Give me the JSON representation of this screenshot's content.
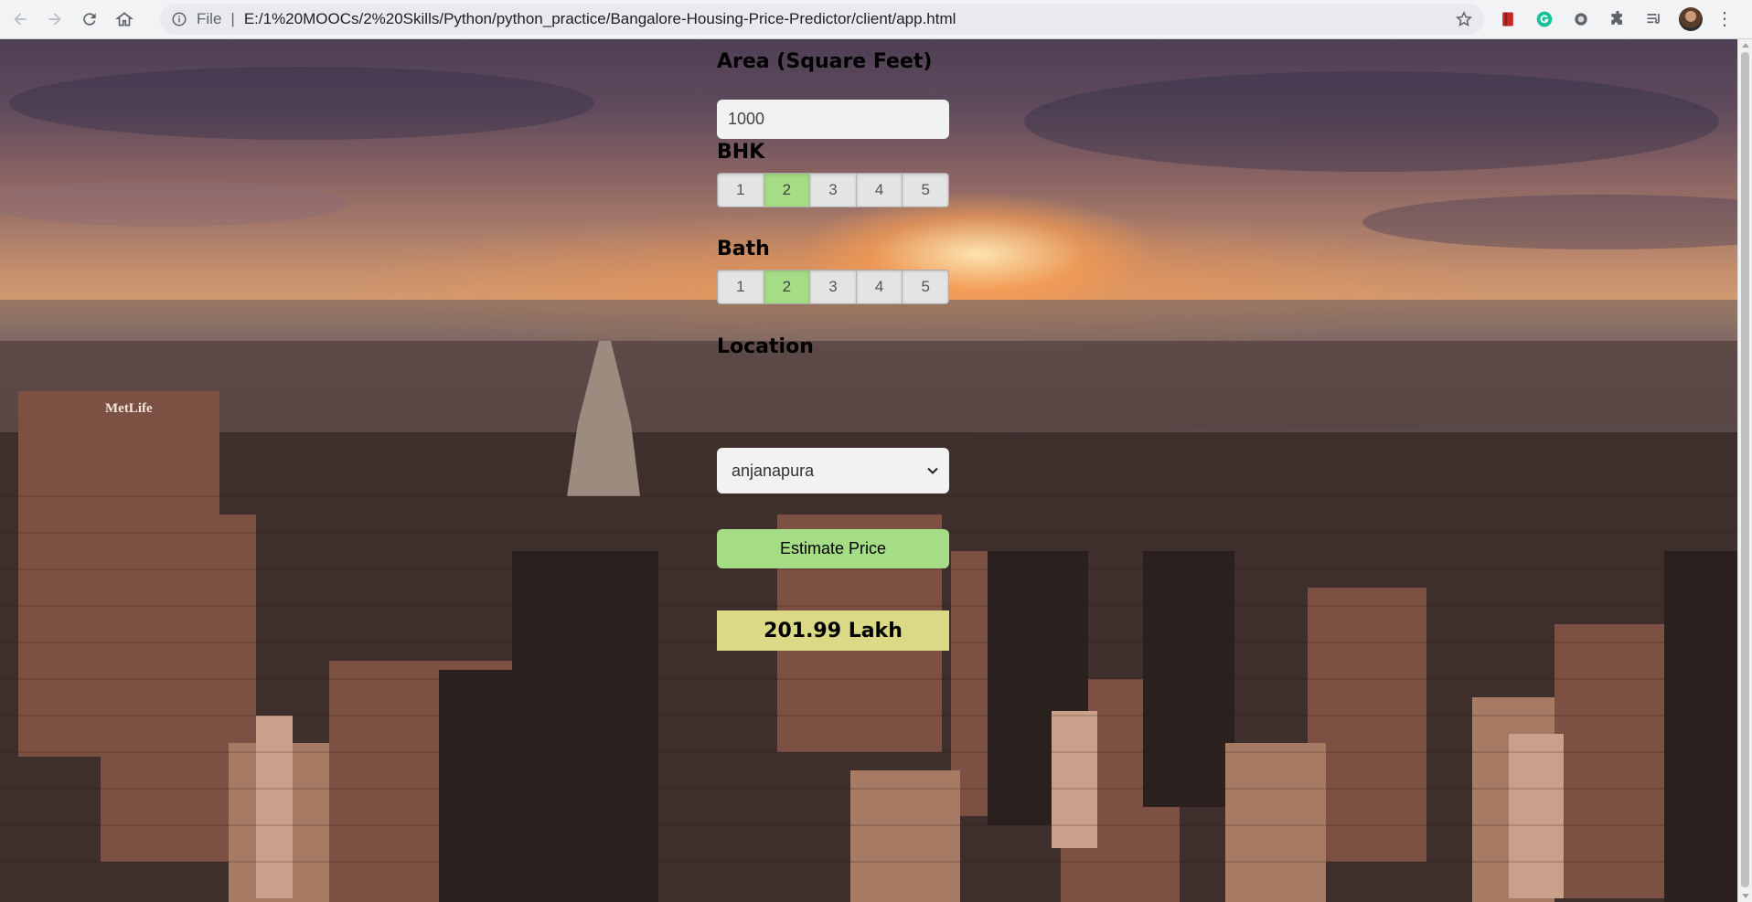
{
  "browser": {
    "url_scheme_label": "File",
    "url": "E:/1%20MOOCs/2%20Skills/Python/python_practice/Bangalore-Housing-Price-Predictor/client/app.html"
  },
  "form": {
    "area_label": "Area (Square Feet)",
    "area_value": "1000",
    "bhk_label": "BHK",
    "bhk_options": [
      "1",
      "2",
      "3",
      "4",
      "5"
    ],
    "bhk_selected": "2",
    "bath_label": "Bath",
    "bath_options": [
      "1",
      "2",
      "3",
      "4",
      "5"
    ],
    "bath_selected": "2",
    "location_label": "Location",
    "location_value": "anjanapura",
    "estimate_button": "Estimate Price",
    "result": "201.99 Lakh"
  },
  "colors": {
    "selected_option": "#a5dc86",
    "estimate_button": "#a5dc86",
    "result_background": "#dbd886"
  },
  "icons": [
    "back-icon",
    "forward-icon",
    "reload-icon",
    "home-icon",
    "info-icon",
    "star-icon",
    "extension-icons",
    "profile-avatar",
    "menu-icon"
  ],
  "background": {
    "billboard_text": "MetLife"
  }
}
